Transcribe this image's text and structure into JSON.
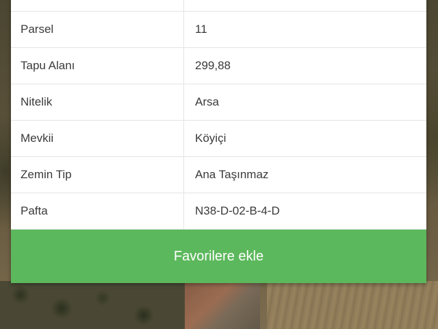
{
  "parcel_info": {
    "rows": [
      {
        "label": "",
        "value": ""
      },
      {
        "label": "Parsel",
        "value": "11"
      },
      {
        "label": "Tapu Alanı",
        "value": "299,88"
      },
      {
        "label": "Nitelik",
        "value": "Arsa"
      },
      {
        "label": "Mevkii",
        "value": "Köyiçi"
      },
      {
        "label": "Zemin Tip",
        "value": "Ana Taşınmaz"
      },
      {
        "label": "Pafta",
        "value": "N38-D-02-B-4-D"
      }
    ]
  },
  "actions": {
    "favorite_label": "Favorilere ekle"
  },
  "colors": {
    "button_green": "#5cb85c",
    "card_bg": "#ffffff",
    "text": "#3a3a3a"
  }
}
